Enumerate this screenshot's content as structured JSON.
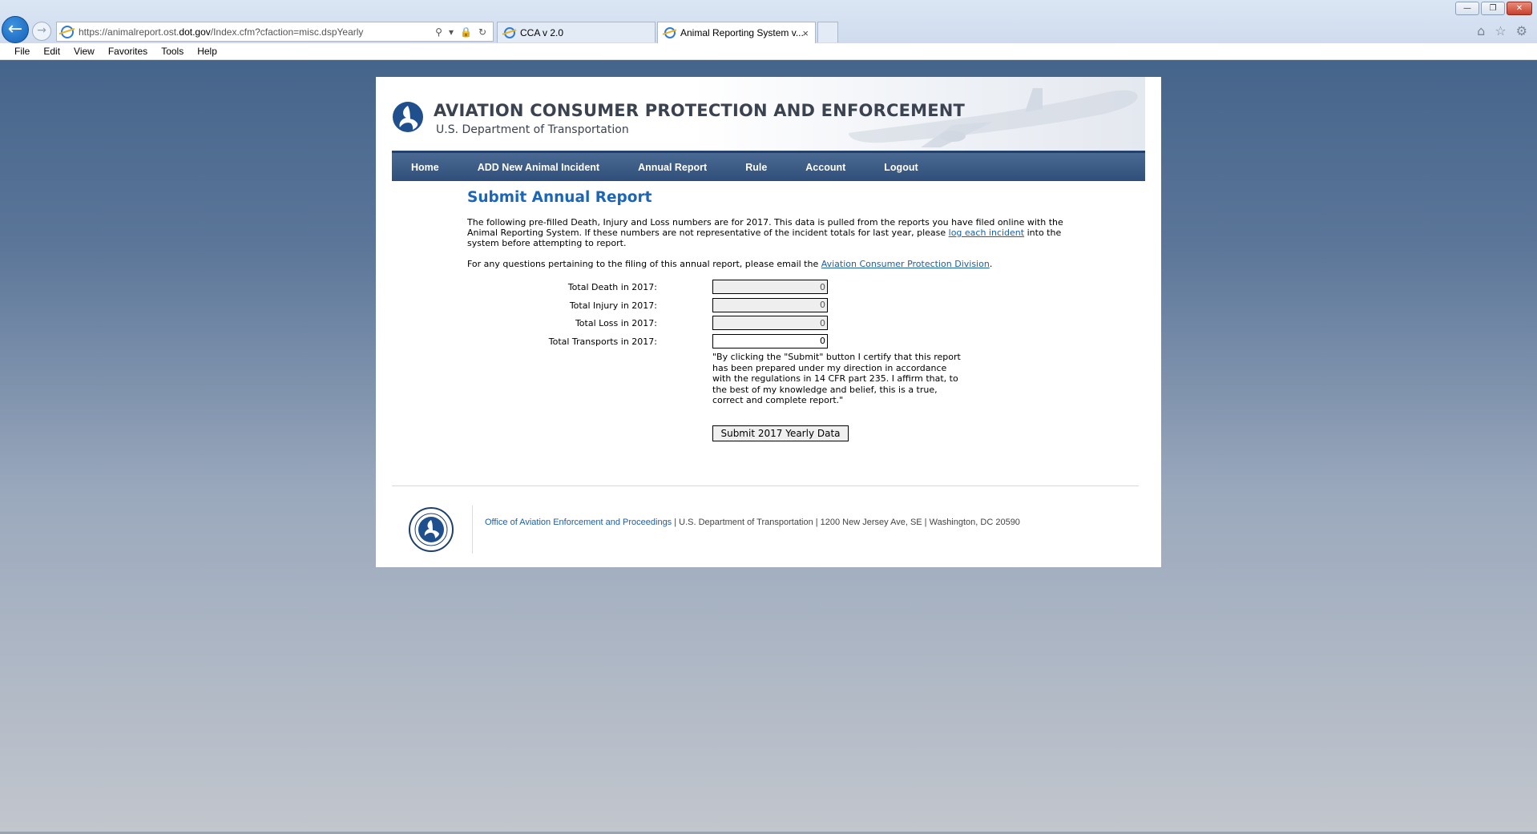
{
  "browser": {
    "url_prefix": "https://animalreport.ost.",
    "url_domain": "dot.gov",
    "url_suffix": "/Index.cfm?cfaction=misc.dspYearly",
    "tabs": [
      {
        "label": "CCA v 2.0"
      },
      {
        "label": "Animal Reporting System v...",
        "close": "×"
      }
    ],
    "menu": [
      "File",
      "Edit",
      "View",
      "Favorites",
      "Tools",
      "Help"
    ]
  },
  "header": {
    "title": "AVIATION CONSUMER PROTECTION AND ENFORCEMENT",
    "subtitle": "U.S. Department of Transportation"
  },
  "nav": [
    "Home",
    "ADD New Animal Incident",
    "Annual Report",
    "Rule",
    "Account",
    "Logout"
  ],
  "main": {
    "title": "Submit Annual Report",
    "intro_a": "The following pre-filled Death, Injury and Loss numbers are for 2017. This data is pulled from the reports you have filed online with the Animal Reporting System. If these numbers are not representative of the incident totals for last year, please ",
    "intro_link": "log each incident",
    "intro_b": " into the system before attempting to report.",
    "contact_a": "For any questions pertaining to the filing of this annual report, please email the ",
    "contact_link": "Aviation Consumer Protection Division",
    "contact_b": "."
  },
  "form": {
    "rows": [
      {
        "label": "Total Death in 2017:",
        "value": "0"
      },
      {
        "label": "Total Injury in 2017:",
        "value": "0"
      },
      {
        "label": "Total Loss in 2017:",
        "value": "0"
      },
      {
        "label": "Total Transports in 2017:",
        "value": "0"
      }
    ],
    "certify": "\"By clicking the \"Submit\" button I certify that this report has been prepared under my direction in accordance with the regulations in 14 CFR part 235. I affirm that, to the best of my knowledge and belief, this is a true, correct and complete report.\"",
    "submit_label": "Submit 2017 Yearly Data"
  },
  "footer": {
    "office_link": "Office of Aviation Enforcement and Proceedings",
    "address": " | U.S. Department of Transportation | 1200 New Jersey Ave, SE | Washington, DC 20590"
  },
  "colors": {
    "accent_blue": "#1a66b8",
    "nav_bg": "#2f4e79"
  }
}
